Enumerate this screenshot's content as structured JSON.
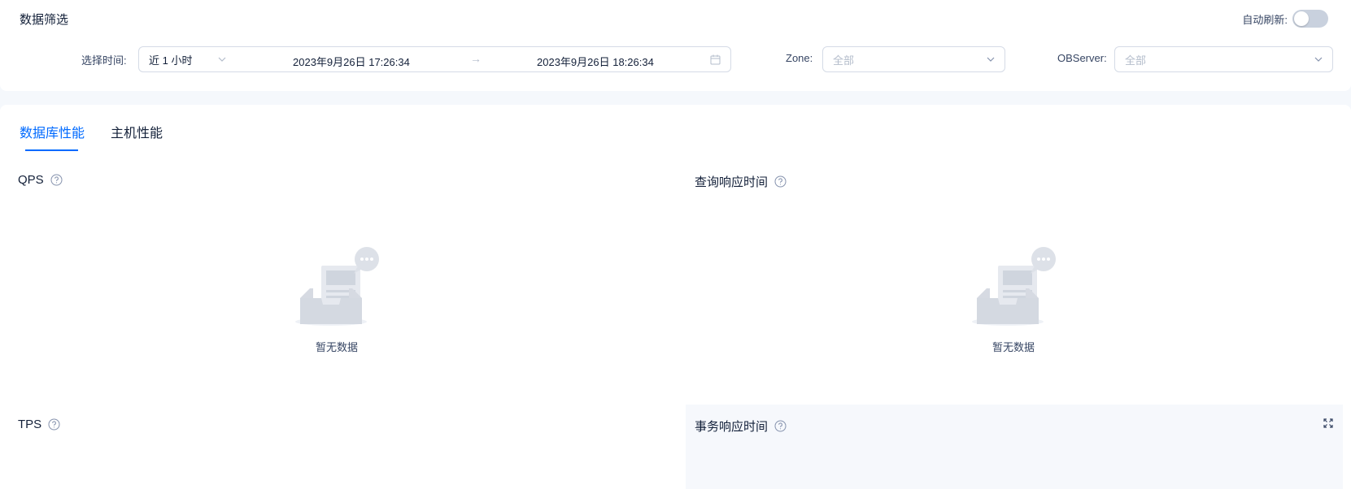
{
  "filter": {
    "title": "数据筛选",
    "auto_refresh_label": "自动刷新:",
    "auto_refresh_on": false,
    "time_label": "选择时间:",
    "time_preset": "近 1 小时",
    "range_start": "2023年9月26日 17:26:34",
    "range_separator": "→",
    "range_end": "2023年9月26日 18:26:34",
    "zone_label": "Zone:",
    "zone_placeholder": "全部",
    "observer_label": "OBServer:",
    "observer_placeholder": "全部"
  },
  "tabs": [
    {
      "label": "数据库性能",
      "active": true
    },
    {
      "label": "主机性能",
      "active": false
    }
  ],
  "panels": [
    {
      "title": "QPS",
      "empty_text": "暂无数据"
    },
    {
      "title": "查询响应时间",
      "empty_text": "暂无数据"
    },
    {
      "title": "TPS"
    },
    {
      "title": "事务响应时间"
    }
  ],
  "colors": {
    "accent": "#006aff",
    "text": "#132039",
    "muted": "#364563",
    "placeholder": "#b3bccb"
  }
}
